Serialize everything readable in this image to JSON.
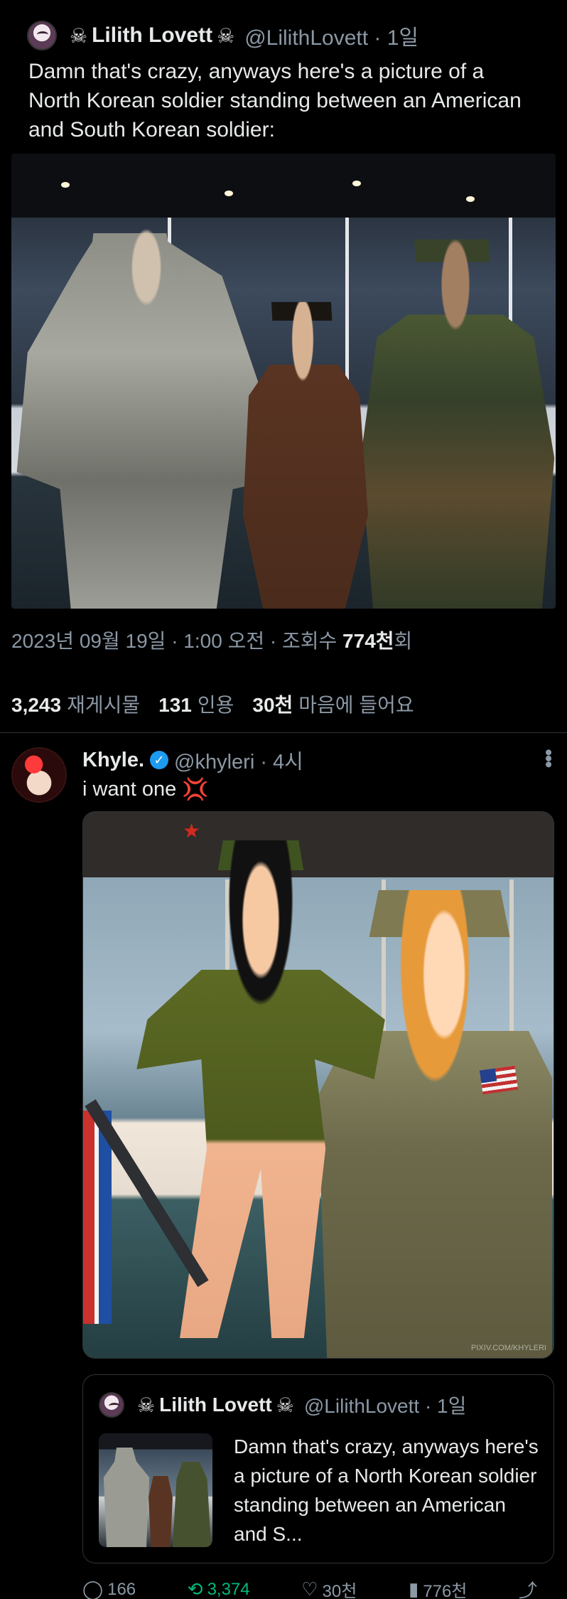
{
  "original": {
    "display_name": "Lilith Lovett",
    "handle_time": "@LilithLovett · 1일",
    "text": "Damn that's crazy, anyways here's a picture of a North Korean soldier standing between an American and South Korean soldier:",
    "timestamp": "2023년 09월 19일 · 1:00 오전 · 조회수",
    "views": "774천",
    "views_suffix": "회",
    "stats": {
      "reposts": "3,243",
      "reposts_label": "재게시물",
      "quotes": "131",
      "quotes_label": "인용",
      "likes": "30천",
      "likes_label": "마음에 들어요"
    }
  },
  "reply": {
    "display_name": "Khyle.",
    "handle_time": "@khyleri · 4시",
    "text": "i want one",
    "image_watermark": "PIXIV.COM/KHYLERI",
    "quote": {
      "display_name": "Lilith Lovett",
      "handle_time": "@LilithLovett · 1일",
      "text": "Damn that's crazy, anyways here's a picture of a North Korean soldier standing between an American and S..."
    },
    "actions": {
      "replies": "166",
      "reposts": "3,374",
      "likes": "30천",
      "views": "776천"
    }
  },
  "colors": {
    "accent": "#1d9bf0",
    "repost_green": "#00ba7c",
    "muted": "#8b98a5"
  }
}
